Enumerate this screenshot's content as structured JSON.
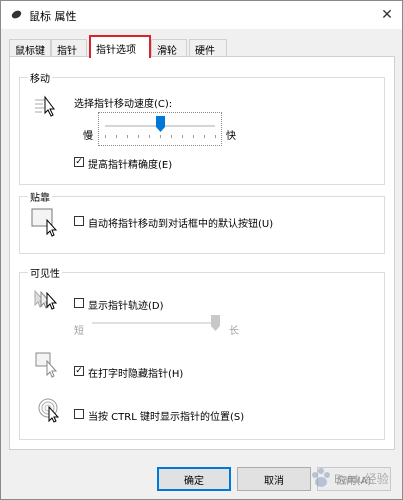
{
  "window": {
    "title": "鼠标 属性",
    "close_glyph": "✕"
  },
  "tabs": [
    {
      "label": "鼠标键",
      "active": false
    },
    {
      "label": "指针",
      "active": false
    },
    {
      "label": "指针选项",
      "active": true
    },
    {
      "label": "滑轮",
      "active": false
    },
    {
      "label": "硬件",
      "active": false
    }
  ],
  "motion": {
    "title": "移动",
    "speed_label": "选择指针移动速度(C):",
    "slow_label": "慢",
    "fast_label": "快",
    "speed_level": 0.5,
    "precision_label": "提高指针精确度(E)",
    "precision_checked": true
  },
  "snap": {
    "title": "贴靠",
    "label": "自动将指针移动到对话框中的默认按钮(U)",
    "checked": false
  },
  "visibility": {
    "title": "可见性",
    "trails_label": "显示指针轨迹(D)",
    "trails_checked": false,
    "short_label": "短",
    "long_label": "长",
    "trails_level": 1.0,
    "hide_typing_label": "在打字时隐藏指针(H)",
    "hide_typing_checked": true,
    "ctrl_label": "当按 CTRL 键时显示指针的位置(S)",
    "ctrl_checked": false
  },
  "buttons": {
    "ok": "确定",
    "cancel": "取消",
    "apply": "应用(A)"
  },
  "watermark": {
    "text": "Baidu经验"
  },
  "colors": {
    "accent": "#0078d7",
    "highlight_border": "#d9252a"
  }
}
